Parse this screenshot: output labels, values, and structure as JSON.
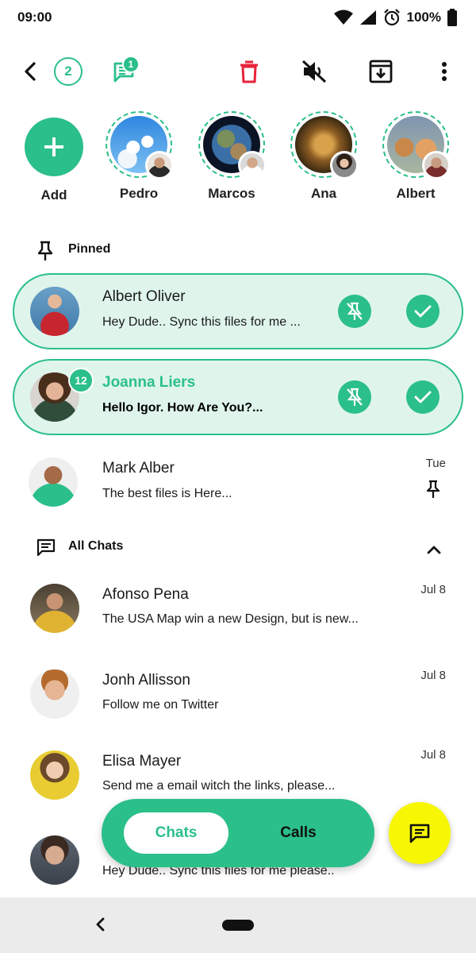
{
  "status_bar": {
    "time": "09:00",
    "battery": "100%",
    "icons": [
      "wifi-icon",
      "signal-icon",
      "alarm-icon",
      "battery-icon"
    ]
  },
  "toolbar": {
    "selected_count": "2",
    "message_badge": "1",
    "icons": [
      "back-icon",
      "message-icon",
      "delete-icon",
      "mute-icon",
      "archive-icon",
      "more-icon"
    ]
  },
  "stories": {
    "add_label": "Add",
    "items": [
      {
        "name": "Pedro"
      },
      {
        "name": "Marcos"
      },
      {
        "name": "Ana"
      },
      {
        "name": "Albert"
      }
    ]
  },
  "sections": {
    "pinned": "Pinned",
    "all_chats": "All Chats"
  },
  "pinned_chats": [
    {
      "name": "Albert Oliver",
      "preview": "Hey Dude.. Sync this files for me ..."
    },
    {
      "name": "Joanna Liers",
      "preview": "Hello Igor. How Are You?...",
      "unread": "12"
    },
    {
      "name": "Mark Alber",
      "preview": "The best files is Here...",
      "time": "Tue"
    }
  ],
  "chats": [
    {
      "name": "Afonso Pena",
      "preview": "The USA Map win a new Design, but is new...",
      "time": "Jul 8"
    },
    {
      "name": "Jonh Allisson",
      "preview": "Follow me on Twitter",
      "time": "Jul 8"
    },
    {
      "name": "Elisa Mayer",
      "preview": "Send me a email witch the links, please...",
      "time": "Jul 8"
    },
    {
      "name": "",
      "preview": "Hey Dude.. Sync this files for me please.."
    }
  ],
  "tabs": {
    "chats": "Chats",
    "calls": "Calls"
  },
  "colors": {
    "accent": "#2bbf8a",
    "pinned_bg": "#dff5ec",
    "delete": "#e8233a",
    "fab": "#f7f704"
  }
}
